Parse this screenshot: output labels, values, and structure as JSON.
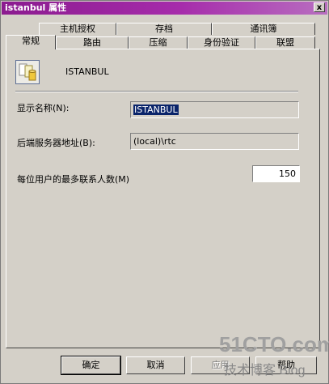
{
  "window": {
    "title": "istanbul 属性",
    "close_label": "x"
  },
  "tabs_row_back": [
    "主机授权",
    "存档",
    "通讯簿"
  ],
  "tabs_row_front": [
    "常规",
    "路由",
    "压缩",
    "身份验证",
    "联盟"
  ],
  "active_tab": "常规",
  "server": {
    "name": "ISTANBUL"
  },
  "fields": {
    "display_name": {
      "label": "显示名称(N):",
      "value": "ISTANBUL"
    },
    "backend_address": {
      "label": "后端服务器地址(B):",
      "value": "(local)\\rtc"
    },
    "max_contacts": {
      "label": "每位用户的最多联系人数(M)",
      "value": "150"
    }
  },
  "buttons": {
    "ok": "确定",
    "cancel": "取消",
    "apply": "应用",
    "help": "帮助"
  },
  "watermark": {
    "line1": "51CTO.com",
    "line2": "技术博客 Blog"
  }
}
